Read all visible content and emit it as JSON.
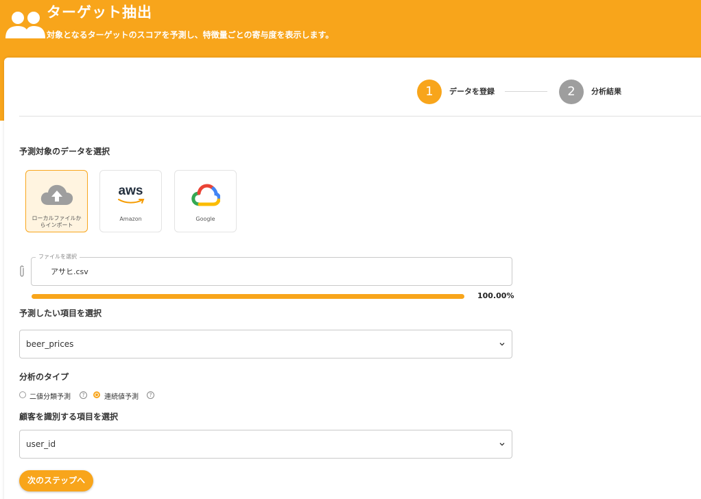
{
  "header": {
    "title": "ターゲット抽出",
    "subtitle": "対象となるターゲットのスコアを予測し、特徴量ごとの寄与度を表示します。",
    "icon": "users-icon"
  },
  "stepper": {
    "steps": [
      {
        "number": "1",
        "label": "データを登録",
        "state": "active"
      },
      {
        "number": "2",
        "label": "分析結果",
        "state": "inactive"
      }
    ]
  },
  "data_source": {
    "label": "予測対象のデータを選択",
    "options": [
      {
        "label": "ローカルファイルか",
        "label2": "らインポート",
        "icon": "cloud-upload-icon",
        "selected": true
      },
      {
        "label": "Amazon",
        "logo_text": "aws",
        "icon": "aws-logo",
        "selected": false
      },
      {
        "label": "Google",
        "icon": "google-cloud-logo",
        "selected": false
      }
    ]
  },
  "file_input": {
    "legend": "ファイルを選択",
    "value": "アサヒ.csv",
    "icon": "paperclip-icon"
  },
  "progress": {
    "value": 1.0,
    "text": "100.00%"
  },
  "target_field": {
    "label": "予測したい項目を選択",
    "value": "beer_prices"
  },
  "analysis_type": {
    "label": "分析のタイプ",
    "options": [
      {
        "label": "二値分類予測",
        "checked": false
      },
      {
        "label": "連続値予測",
        "checked": true
      }
    ]
  },
  "customer_field": {
    "label": "顧客を識別する項目を選択",
    "value": "user_id"
  },
  "next_button": {
    "label": "次のステップへ"
  },
  "colors": {
    "accent": "#f8a51b",
    "inactive": "#9e9e9e"
  }
}
